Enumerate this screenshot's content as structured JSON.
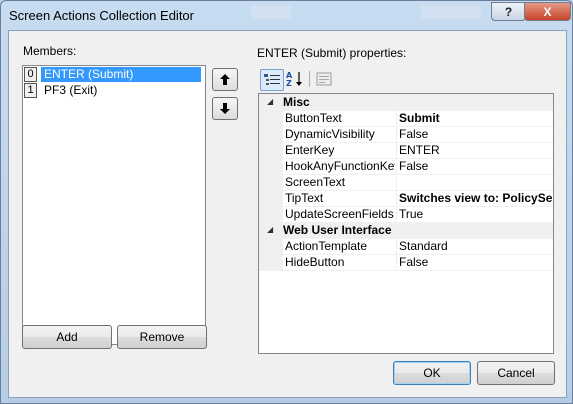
{
  "window": {
    "title": "Screen Actions Collection Editor",
    "help_glyph": "?",
    "close_glyph": "X"
  },
  "members": {
    "label": "Members:",
    "items": [
      {
        "index": "0",
        "label": "ENTER (Submit)",
        "selected": true
      },
      {
        "index": "1",
        "label": "PF3 (Exit)",
        "selected": false
      }
    ],
    "add_label": "Add",
    "remove_label": "Remove"
  },
  "properties": {
    "label": "ENTER (Submit) properties:",
    "categories": [
      {
        "name": "Misc",
        "rows": [
          {
            "name": "ButtonText",
            "value": "Submit",
            "bold": true
          },
          {
            "name": "DynamicVisibility",
            "value": "False",
            "bold": false
          },
          {
            "name": "EnterKey",
            "value": "ENTER",
            "bold": false
          },
          {
            "name": "HookAnyFunctionKey",
            "value": "False",
            "bold": false
          },
          {
            "name": "ScreenText",
            "value": "",
            "bold": false
          },
          {
            "name": "TipText",
            "value": "Switches view to: PolicySel",
            "bold": true
          },
          {
            "name": "UpdateScreenFields",
            "value": "True",
            "bold": false
          }
        ]
      },
      {
        "name": "Web User Interface",
        "rows": [
          {
            "name": "ActionTemplate",
            "value": "Standard",
            "bold": false
          },
          {
            "name": "HideButton",
            "value": "False",
            "bold": false
          }
        ]
      }
    ]
  },
  "footer": {
    "ok_label": "OK",
    "cancel_label": "Cancel"
  },
  "icons": {
    "categorized": "categorized-icon",
    "alphabetical": "sort-alpha-icon",
    "property_pages": "property-pages-icon",
    "move_up": "arrow-up-icon",
    "move_down": "arrow-down-icon",
    "collapse": "collapse-triangle-icon"
  },
  "colors": {
    "selection": "#3399ff",
    "titlebar": "#c7dcf0",
    "close": "#c7432a"
  }
}
